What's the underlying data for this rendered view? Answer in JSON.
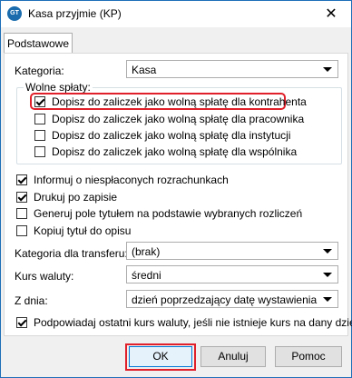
{
  "window": {
    "icon_text": "GT",
    "title": "Kasa przyjmie (KP)",
    "close_glyph": "✕"
  },
  "tabs": [
    {
      "label": "Podstawowe",
      "active": true
    }
  ],
  "form": {
    "kategoria_label": "Kategoria:",
    "kategoria_value": "Kasa",
    "wolne_splaty": {
      "title": "Wolne spłaty:",
      "items": [
        {
          "label": "Dopisz do zaliczek jako wolną spłatę dla kontrahenta",
          "checked": true,
          "highlighted": true
        },
        {
          "label": "Dopisz do zaliczek jako wolną spłatę dla pracownika",
          "checked": false
        },
        {
          "label": "Dopisz do zaliczek jako wolną spłatę dla instytucji",
          "checked": false
        },
        {
          "label": "Dopisz do zaliczek jako wolną spłatę dla wspólnika",
          "checked": false
        }
      ]
    },
    "options": [
      {
        "label": "Informuj o niespłaconych rozrachunkach",
        "checked": true
      },
      {
        "label": "Drukuj po zapisie",
        "checked": true
      },
      {
        "label": "Generuj pole tytułem na podstawie wybranych rozliczeń",
        "checked": false
      },
      {
        "label": "Kopiuj tytuł do opisu",
        "checked": false
      }
    ],
    "kategoria_transferu_label": "Kategoria dla transferu:",
    "kategoria_transferu_value": "(brak)",
    "kurs_waluty_label": "Kurs waluty:",
    "kurs_waluty_value": "średni",
    "z_dnia_label": "Z dnia:",
    "z_dnia_value": "dzień poprzedzający datę wystawienia",
    "podpowiadaj": {
      "label": "Podpowiadaj ostatni kurs waluty, jeśli nie istnieje kurs na dany dzień",
      "checked": true
    }
  },
  "buttons": {
    "ok": "OK",
    "cancel": "Anuluj",
    "help": "Pomoc"
  },
  "colors": {
    "highlight": "#e0202a",
    "title_border": "#1f6fb8"
  }
}
